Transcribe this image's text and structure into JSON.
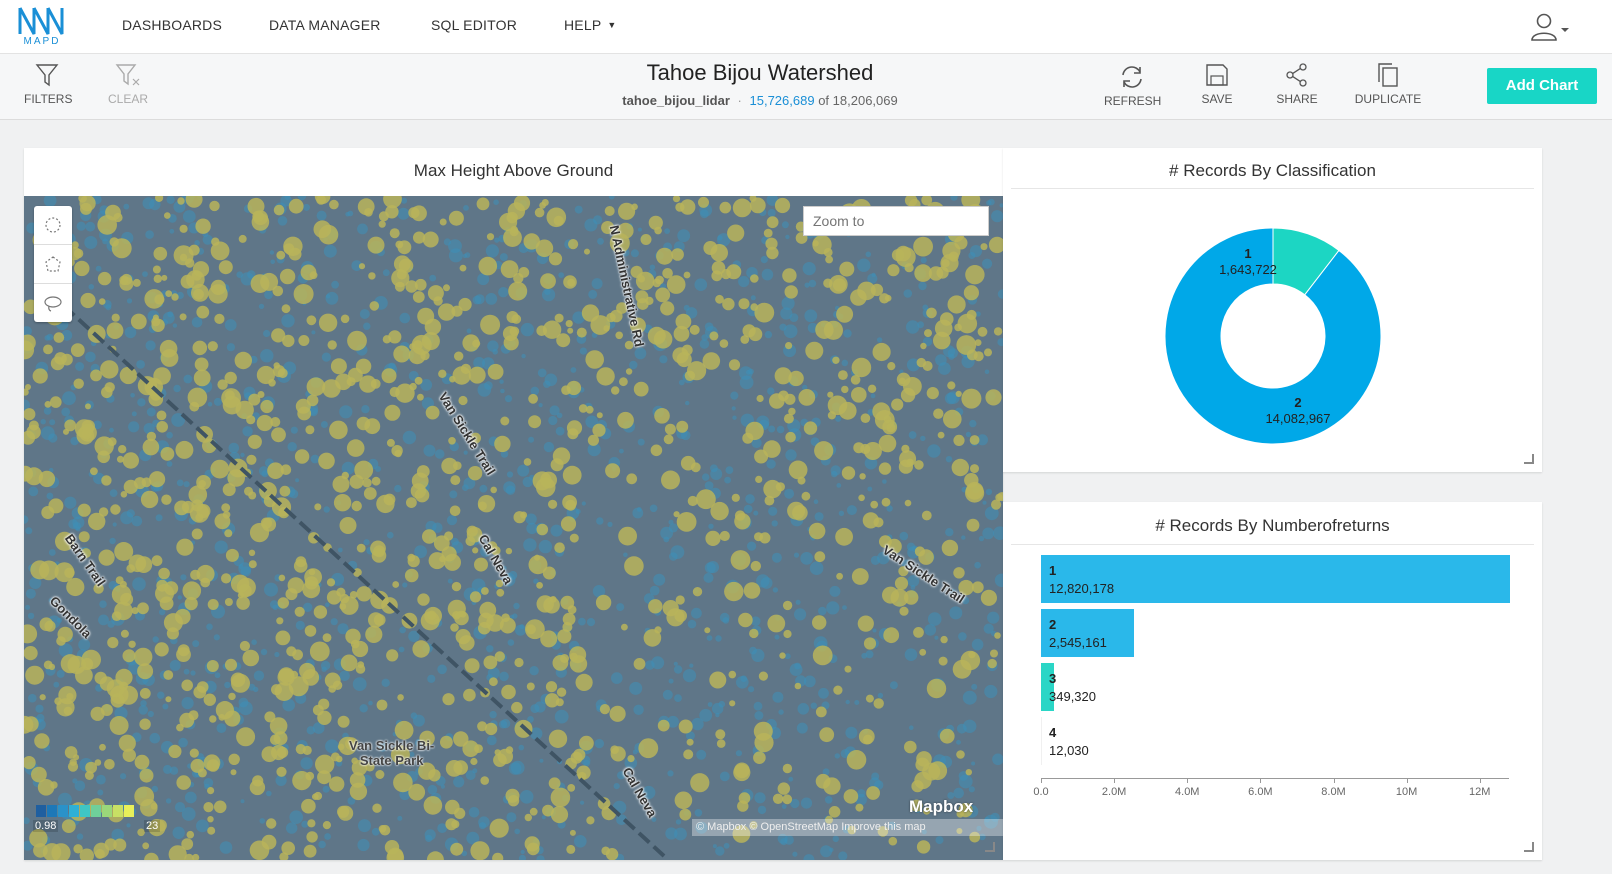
{
  "nav": {
    "logo_text": "MAPD",
    "items": [
      {
        "label": "DASHBOARDS"
      },
      {
        "label": "DATA MANAGER"
      },
      {
        "label": "SQL EDITOR"
      },
      {
        "label": "HELP",
        "has_dropdown": true
      }
    ],
    "user_icon": "user-icon"
  },
  "toolbar": {
    "filters_label": "FILTERS",
    "clear_label": "CLEAR",
    "refresh_label": "REFRESH",
    "save_label": "SAVE",
    "share_label": "SHARE",
    "duplicate_label": "DUPLICATE",
    "add_chart_label": "Add Chart"
  },
  "dashboard": {
    "title": "Tahoe Bijou Watershed",
    "table_name": "tahoe_bijou_lidar",
    "separator": "·",
    "filtered_count": "15,726,689",
    "of_text": "of 18,206,069"
  },
  "map_panel": {
    "title": "Max Height Above Ground",
    "zoom_placeholder": "Zoom to",
    "roads": [
      {
        "name": "N Administrative Rd"
      },
      {
        "name": "Van Sickle Trail"
      },
      {
        "name": "Cal Neva"
      },
      {
        "name": "Barn Trail"
      },
      {
        "name": "Gondola"
      },
      {
        "name": "Van Sickle Trail"
      },
      {
        "name": "Cal Neva"
      }
    ],
    "park_label_1": "Van Sickle Bi-",
    "park_label_2": "State Park",
    "mapbox_logo": "Mapbox",
    "attribution": "© Mapbox   © OpenStreetMap   Improve this map",
    "legend": {
      "min": "0.98",
      "max": "23",
      "colors": [
        "#1f5fa0",
        "#1d78b8",
        "#2a92c9",
        "#2fb0d6",
        "#3fc6c4",
        "#6fcf9a",
        "#9bd77a",
        "#c8e064",
        "#e8f05a"
      ]
    },
    "colors": {
      "base": "#5f7688",
      "canopy": "#b8b45a",
      "blue_points": "#3e8fb8"
    }
  },
  "classification_chart": {
    "title": "# Records By Classification",
    "chart_data": {
      "type": "pie",
      "categories": [
        "1",
        "2"
      ],
      "values": [
        1643722,
        14082967
      ],
      "value_labels": [
        "1,643,722",
        "14,082,967"
      ],
      "colors": [
        "#1cd6c3",
        "#00a8e8"
      ],
      "donut": true
    }
  },
  "returns_chart": {
    "title": "# Records By Numberofreturns",
    "chart_data": {
      "type": "bar",
      "orientation": "horizontal",
      "categories": [
        "1",
        "2",
        "3",
        "4"
      ],
      "values": [
        12820178,
        2545161,
        349320,
        12030
      ],
      "value_labels": [
        "12,820,178",
        "2,545,161",
        "349,320",
        "12,030"
      ],
      "colors": [
        "#2ab8ea",
        "#2ab8ea",
        "#2ad6c6",
        "#f0f0f0"
      ],
      "xlim": [
        0,
        12800000
      ],
      "xticks": [
        "0.0",
        "2.0M",
        "4.0M",
        "6.0M",
        "8.0M",
        "10M",
        "12M"
      ]
    }
  }
}
